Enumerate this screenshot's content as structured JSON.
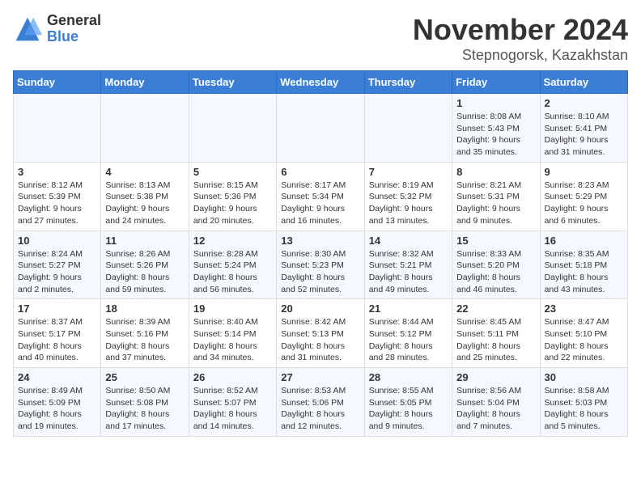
{
  "logo": {
    "general": "General",
    "blue": "Blue"
  },
  "title": "November 2024",
  "location": "Stepnogorsk, Kazakhstan",
  "days_of_week": [
    "Sunday",
    "Monday",
    "Tuesday",
    "Wednesday",
    "Thursday",
    "Friday",
    "Saturday"
  ],
  "weeks": [
    [
      {
        "day": "",
        "info": ""
      },
      {
        "day": "",
        "info": ""
      },
      {
        "day": "",
        "info": ""
      },
      {
        "day": "",
        "info": ""
      },
      {
        "day": "",
        "info": ""
      },
      {
        "day": "1",
        "info": "Sunrise: 8:08 AM\nSunset: 5:43 PM\nDaylight: 9 hours and 35 minutes."
      },
      {
        "day": "2",
        "info": "Sunrise: 8:10 AM\nSunset: 5:41 PM\nDaylight: 9 hours and 31 minutes."
      }
    ],
    [
      {
        "day": "3",
        "info": "Sunrise: 8:12 AM\nSunset: 5:39 PM\nDaylight: 9 hours and 27 minutes."
      },
      {
        "day": "4",
        "info": "Sunrise: 8:13 AM\nSunset: 5:38 PM\nDaylight: 9 hours and 24 minutes."
      },
      {
        "day": "5",
        "info": "Sunrise: 8:15 AM\nSunset: 5:36 PM\nDaylight: 9 hours and 20 minutes."
      },
      {
        "day": "6",
        "info": "Sunrise: 8:17 AM\nSunset: 5:34 PM\nDaylight: 9 hours and 16 minutes."
      },
      {
        "day": "7",
        "info": "Sunrise: 8:19 AM\nSunset: 5:32 PM\nDaylight: 9 hours and 13 minutes."
      },
      {
        "day": "8",
        "info": "Sunrise: 8:21 AM\nSunset: 5:31 PM\nDaylight: 9 hours and 9 minutes."
      },
      {
        "day": "9",
        "info": "Sunrise: 8:23 AM\nSunset: 5:29 PM\nDaylight: 9 hours and 6 minutes."
      }
    ],
    [
      {
        "day": "10",
        "info": "Sunrise: 8:24 AM\nSunset: 5:27 PM\nDaylight: 9 hours and 2 minutes."
      },
      {
        "day": "11",
        "info": "Sunrise: 8:26 AM\nSunset: 5:26 PM\nDaylight: 8 hours and 59 minutes."
      },
      {
        "day": "12",
        "info": "Sunrise: 8:28 AM\nSunset: 5:24 PM\nDaylight: 8 hours and 56 minutes."
      },
      {
        "day": "13",
        "info": "Sunrise: 8:30 AM\nSunset: 5:23 PM\nDaylight: 8 hours and 52 minutes."
      },
      {
        "day": "14",
        "info": "Sunrise: 8:32 AM\nSunset: 5:21 PM\nDaylight: 8 hours and 49 minutes."
      },
      {
        "day": "15",
        "info": "Sunrise: 8:33 AM\nSunset: 5:20 PM\nDaylight: 8 hours and 46 minutes."
      },
      {
        "day": "16",
        "info": "Sunrise: 8:35 AM\nSunset: 5:18 PM\nDaylight: 8 hours and 43 minutes."
      }
    ],
    [
      {
        "day": "17",
        "info": "Sunrise: 8:37 AM\nSunset: 5:17 PM\nDaylight: 8 hours and 40 minutes."
      },
      {
        "day": "18",
        "info": "Sunrise: 8:39 AM\nSunset: 5:16 PM\nDaylight: 8 hours and 37 minutes."
      },
      {
        "day": "19",
        "info": "Sunrise: 8:40 AM\nSunset: 5:14 PM\nDaylight: 8 hours and 34 minutes."
      },
      {
        "day": "20",
        "info": "Sunrise: 8:42 AM\nSunset: 5:13 PM\nDaylight: 8 hours and 31 minutes."
      },
      {
        "day": "21",
        "info": "Sunrise: 8:44 AM\nSunset: 5:12 PM\nDaylight: 8 hours and 28 minutes."
      },
      {
        "day": "22",
        "info": "Sunrise: 8:45 AM\nSunset: 5:11 PM\nDaylight: 8 hours and 25 minutes."
      },
      {
        "day": "23",
        "info": "Sunrise: 8:47 AM\nSunset: 5:10 PM\nDaylight: 8 hours and 22 minutes."
      }
    ],
    [
      {
        "day": "24",
        "info": "Sunrise: 8:49 AM\nSunset: 5:09 PM\nDaylight: 8 hours and 19 minutes."
      },
      {
        "day": "25",
        "info": "Sunrise: 8:50 AM\nSunset: 5:08 PM\nDaylight: 8 hours and 17 minutes."
      },
      {
        "day": "26",
        "info": "Sunrise: 8:52 AM\nSunset: 5:07 PM\nDaylight: 8 hours and 14 minutes."
      },
      {
        "day": "27",
        "info": "Sunrise: 8:53 AM\nSunset: 5:06 PM\nDaylight: 8 hours and 12 minutes."
      },
      {
        "day": "28",
        "info": "Sunrise: 8:55 AM\nSunset: 5:05 PM\nDaylight: 8 hours and 9 minutes."
      },
      {
        "day": "29",
        "info": "Sunrise: 8:56 AM\nSunset: 5:04 PM\nDaylight: 8 hours and 7 minutes."
      },
      {
        "day": "30",
        "info": "Sunrise: 8:58 AM\nSunset: 5:03 PM\nDaylight: 8 hours and 5 minutes."
      }
    ]
  ]
}
